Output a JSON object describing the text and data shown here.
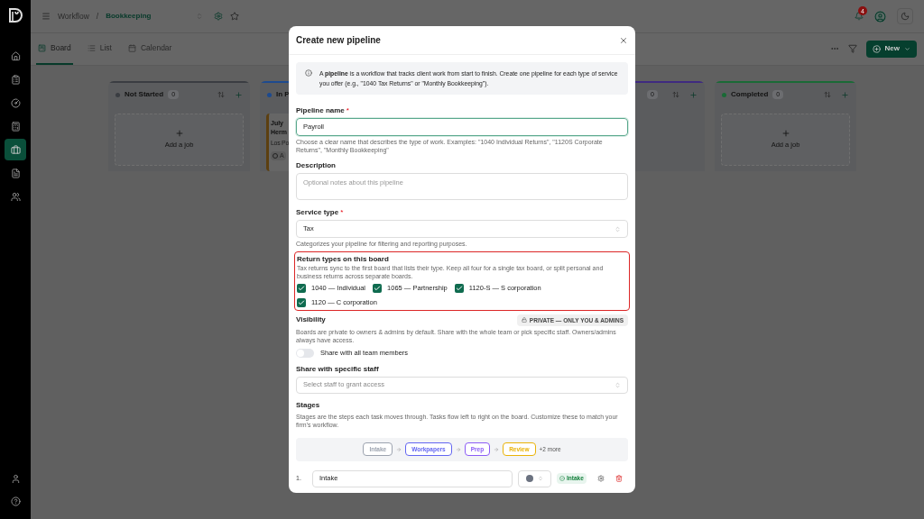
{
  "sidebar": {
    "nav": [
      {
        "selected": false
      },
      {
        "selected": false
      },
      {
        "selected": false
      },
      {
        "selected": false
      },
      {
        "selected": true
      },
      {
        "selected": false
      },
      {
        "selected": false
      }
    ]
  },
  "header": {
    "breadcrumb": [
      "Workflow",
      "/",
      "Bookkeeping"
    ],
    "notification_count": "4"
  },
  "tabs": [
    {
      "label": "Board",
      "selected": true
    },
    {
      "label": "List",
      "selected": false
    },
    {
      "label": "Calendar",
      "selected": false
    }
  ],
  "toolbar": {
    "new_button": "New"
  },
  "board": {
    "columns": [
      {
        "name": "Not Started",
        "count": "0",
        "color": "#3a3d42",
        "add_label": "Add a job"
      },
      {
        "name": "In P",
        "color": "#1d4a8f",
        "card": {
          "title": [
            "July",
            "Herm"
          ],
          "subtitle": "Los Po",
          "meta": "A"
        }
      },
      {
        "count": "0",
        "color": "#3f2a80"
      },
      {
        "name": "Completed",
        "count": "0",
        "color": "#1a6a36",
        "add_label": "Add a job"
      }
    ]
  },
  "dialog": {
    "title": "Create new pipeline",
    "info": "A **pipeline** is a workflow that tracks client work from start to finish. Create one pipeline for each type of service you offer (e.g., \"1040 Tax Returns\" or \"Monthly Bookkeeping\").",
    "pipeline_name": {
      "label": "Pipeline name",
      "required_mark": "*",
      "value": "Payroll",
      "focused": true,
      "help": "Choose a clear name that describes the type of work. Examples: \"1040 Individual Returns\", \"1120S Corporate Returns\", \"Monthly Bookkeeping\""
    },
    "description": {
      "label": "Description",
      "placeholder": "Optional notes about this pipeline"
    },
    "service_type": {
      "label": "Service type",
      "required_mark": "*",
      "value": "Tax",
      "help": "Categorizes your pipeline for filtering and reporting purposes."
    },
    "return_types": {
      "title": "Return types on this board",
      "highlighted": true,
      "help": "Tax returns sync to the first board that lists their type. Keep all four for a single tax board, or split personal and business returns across separate boards.",
      "options": [
        {
          "label": "1040 — Individual",
          "checked": true
        },
        {
          "label": "1065 — Partnership",
          "checked": true
        },
        {
          "label": "1120-S — S corporation",
          "checked": true
        },
        {
          "label": "1120 — C corporation",
          "checked": true
        }
      ]
    },
    "visibility": {
      "title": "Visibility",
      "badge": "PRIVATE — ONLY YOU & ADMINS",
      "help": "Boards are private to owners & admins by default. Share with the whole team or pick specific staff. Owners/admins always have access.",
      "toggle": {
        "label": "Share with all team members",
        "on": false
      }
    },
    "share_staff": {
      "label": "Share with specific staff",
      "placeholder": "Select staff to grant access"
    },
    "stages": {
      "title": "Stages",
      "help": "Stages are the steps each task moves through. Tasks flow left to right on the board. Customize these to match your firm's workflow.",
      "preview": [
        {
          "label": "Intake",
          "color": "#9ca3af"
        },
        {
          "label": "Workpapers",
          "color": "#6366f1"
        },
        {
          "label": "Prep",
          "color": "#8b5cf6"
        },
        {
          "label": "Review",
          "color": "#eab308"
        }
      ],
      "more": "+2 more",
      "rows": [
        {
          "number": "1.",
          "name": "Intake",
          "color": "#6b7280",
          "tag": "Intake"
        }
      ]
    }
  }
}
